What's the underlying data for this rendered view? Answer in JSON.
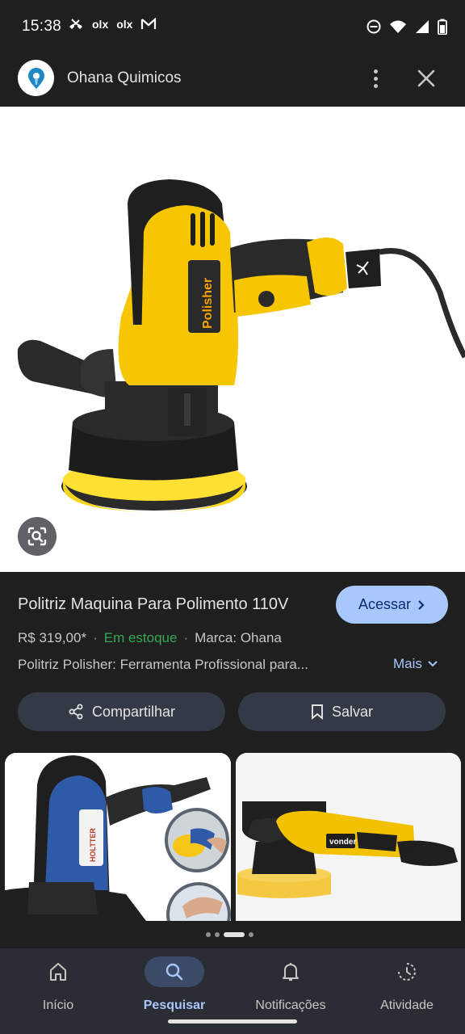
{
  "status_bar": {
    "time": "15:38",
    "notification_icons": [
      "missed-call-icon",
      "olx-icon",
      "olx-icon",
      "gmail-icon"
    ],
    "notification_labels": [
      "olx",
      "olx"
    ],
    "system_icons": [
      "do-not-disturb-icon",
      "wifi-icon",
      "signal-icon",
      "battery-icon"
    ]
  },
  "header": {
    "site_name": "Ohana Quimicos",
    "more_icon": "more-vert-icon",
    "close_icon": "close-icon"
  },
  "product": {
    "title": "Politriz Maquina Para Polimento 110V",
    "visit_label": "Acessar",
    "price": "R$ 319,00*",
    "separator": "·",
    "stock": "Em estoque",
    "brand": "Marca: Ohana",
    "description": "Politriz Polisher: Ferramenta Profissional para...",
    "more_label": "Mais",
    "image_text": "Polisher"
  },
  "actions": {
    "share_label": "Compartilhar",
    "save_label": "Salvar"
  },
  "thumbnails": {
    "thumb1_brand": "HOLTTER",
    "thumb2_brand": "vonder"
  },
  "bottom_nav": {
    "items": [
      {
        "label": "Início",
        "icon": "home-icon"
      },
      {
        "label": "Pesquisar",
        "icon": "search-icon",
        "active": true
      },
      {
        "label": "Notificações",
        "icon": "bell-icon"
      },
      {
        "label": "Atividade",
        "icon": "activity-icon"
      }
    ]
  },
  "colors": {
    "background": "#1f1f1f",
    "accent": "#a8c7fa",
    "stock_green": "#34a853",
    "pill_bg": "#333a45"
  }
}
